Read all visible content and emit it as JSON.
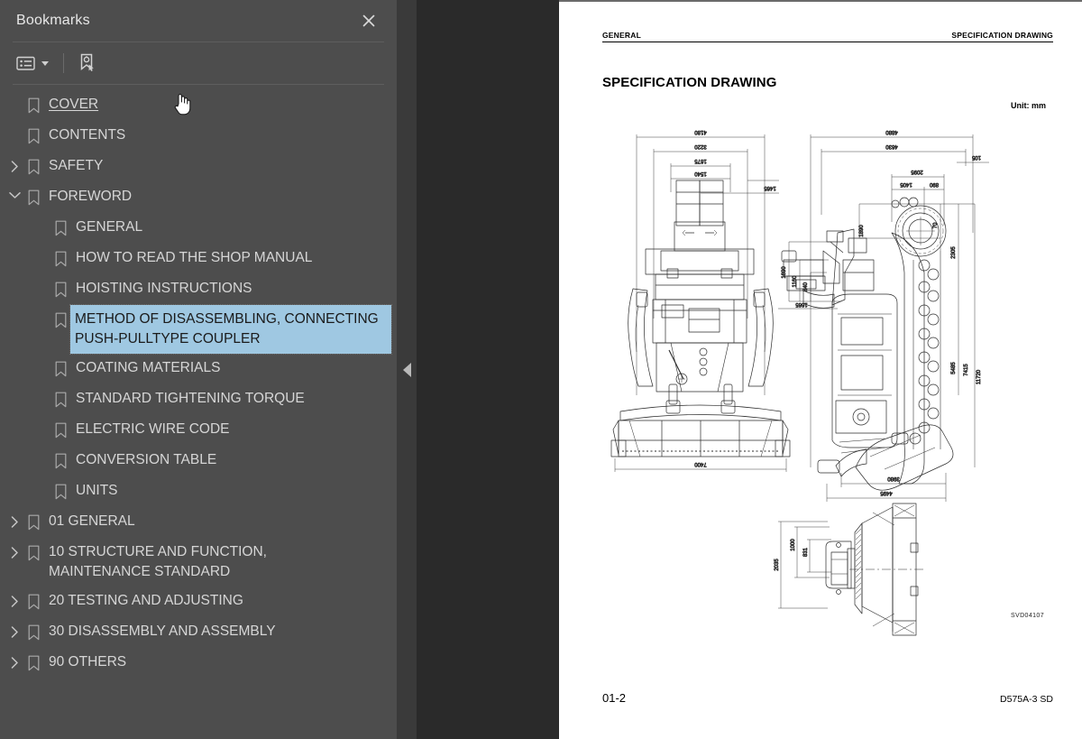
{
  "sidebar": {
    "panel_title": "Bookmarks",
    "close_icon": "close-icon",
    "toolbar": {
      "options_label": "Bookmark options",
      "options_icon": "list-options-icon",
      "caret_icon": "chevron-down-icon",
      "new_bookmark_icon": "new-bookmark-icon",
      "new_bookmark_label": "New bookmark"
    },
    "items": [
      {
        "label": "COVER",
        "level": 0,
        "twisty": "none",
        "selected": false,
        "link": true
      },
      {
        "label": "CONTENTS",
        "level": 0,
        "twisty": "none",
        "selected": false,
        "link": false
      },
      {
        "label": "SAFETY",
        "level": 0,
        "twisty": "collapsed",
        "selected": false,
        "link": false
      },
      {
        "label": "FOREWORD",
        "level": 0,
        "twisty": "expanded",
        "selected": false,
        "link": false
      },
      {
        "label": "GENERAL",
        "level": 1,
        "twisty": "none",
        "selected": false,
        "link": false
      },
      {
        "label": "HOW TO READ THE SHOP MANUAL",
        "level": 1,
        "twisty": "none",
        "selected": false,
        "link": false
      },
      {
        "label": "HOISTING INSTRUCTIONS",
        "level": 1,
        "twisty": "none",
        "selected": false,
        "link": false
      },
      {
        "label": "METHOD OF DISASSEMBLING, CONNECTING PUSH-PULLTYPE COUPLER",
        "level": 1,
        "twisty": "none",
        "selected": true,
        "link": false
      },
      {
        "label": "COATING MATERIALS",
        "level": 1,
        "twisty": "none",
        "selected": false,
        "link": false
      },
      {
        "label": "STANDARD TIGHTENING TORQUE",
        "level": 1,
        "twisty": "none",
        "selected": false,
        "link": false
      },
      {
        "label": "ELECTRIC WIRE CODE",
        "level": 1,
        "twisty": "none",
        "selected": false,
        "link": false
      },
      {
        "label": "CONVERSION TABLE",
        "level": 1,
        "twisty": "none",
        "selected": false,
        "link": false
      },
      {
        "label": "UNITS",
        "level": 1,
        "twisty": "none",
        "selected": false,
        "link": false
      },
      {
        "label": "01 GENERAL",
        "level": 0,
        "twisty": "collapsed",
        "selected": false,
        "link": false
      },
      {
        "label": "10 STRUCTURE AND FUNCTION, MAINTENANCE STANDARD",
        "level": 0,
        "twisty": "collapsed",
        "selected": false,
        "link": false
      },
      {
        "label": "20 TESTING AND ADJUSTING",
        "level": 0,
        "twisty": "collapsed",
        "selected": false,
        "link": false
      },
      {
        "label": "30 DISASSEMBLY AND ASSEMBLY",
        "level": 0,
        "twisty": "collapsed",
        "selected": false,
        "link": false
      },
      {
        "label": "90 OTHERS",
        "level": 0,
        "twisty": "collapsed",
        "selected": false,
        "link": false
      }
    ]
  },
  "splitter": {
    "collapse_icon": "collapse-left-arrow-icon",
    "collapse_label": "Collapse panel"
  },
  "document": {
    "running_head_left": "GENERAL",
    "running_head_right": "SPECIFICATION DRAWING",
    "title": "SPECIFICATION DRAWING",
    "unit_note": "Unit: mm",
    "figure_code": "SVD04107",
    "page_number": "01-2",
    "model_code": "D575A-3 SD"
  },
  "drawing_dimensions": {
    "front_view": [
      "4180",
      "3220",
      "1675",
      "1540",
      "1465",
      "7400"
    ],
    "side_view": [
      "4880",
      "4630",
      "105",
      "2095",
      "1405",
      "890",
      "70",
      "2305",
      "1890",
      "840",
      "1160",
      "1690",
      "1665",
      "5485",
      "7415",
      "11720",
      "3980",
      "4495"
    ],
    "rear_view": [
      "1000",
      "831",
      "2035"
    ]
  },
  "cursor": {
    "icon": "pointing-hand-cursor"
  },
  "colors": {
    "sidebar_bg": "#4d4d4d",
    "viewer_bg": "#2a2a2a",
    "splitter_bg": "#3a3a3a",
    "selection_bg": "#9fc8e2",
    "text": "#d6d6d6"
  }
}
